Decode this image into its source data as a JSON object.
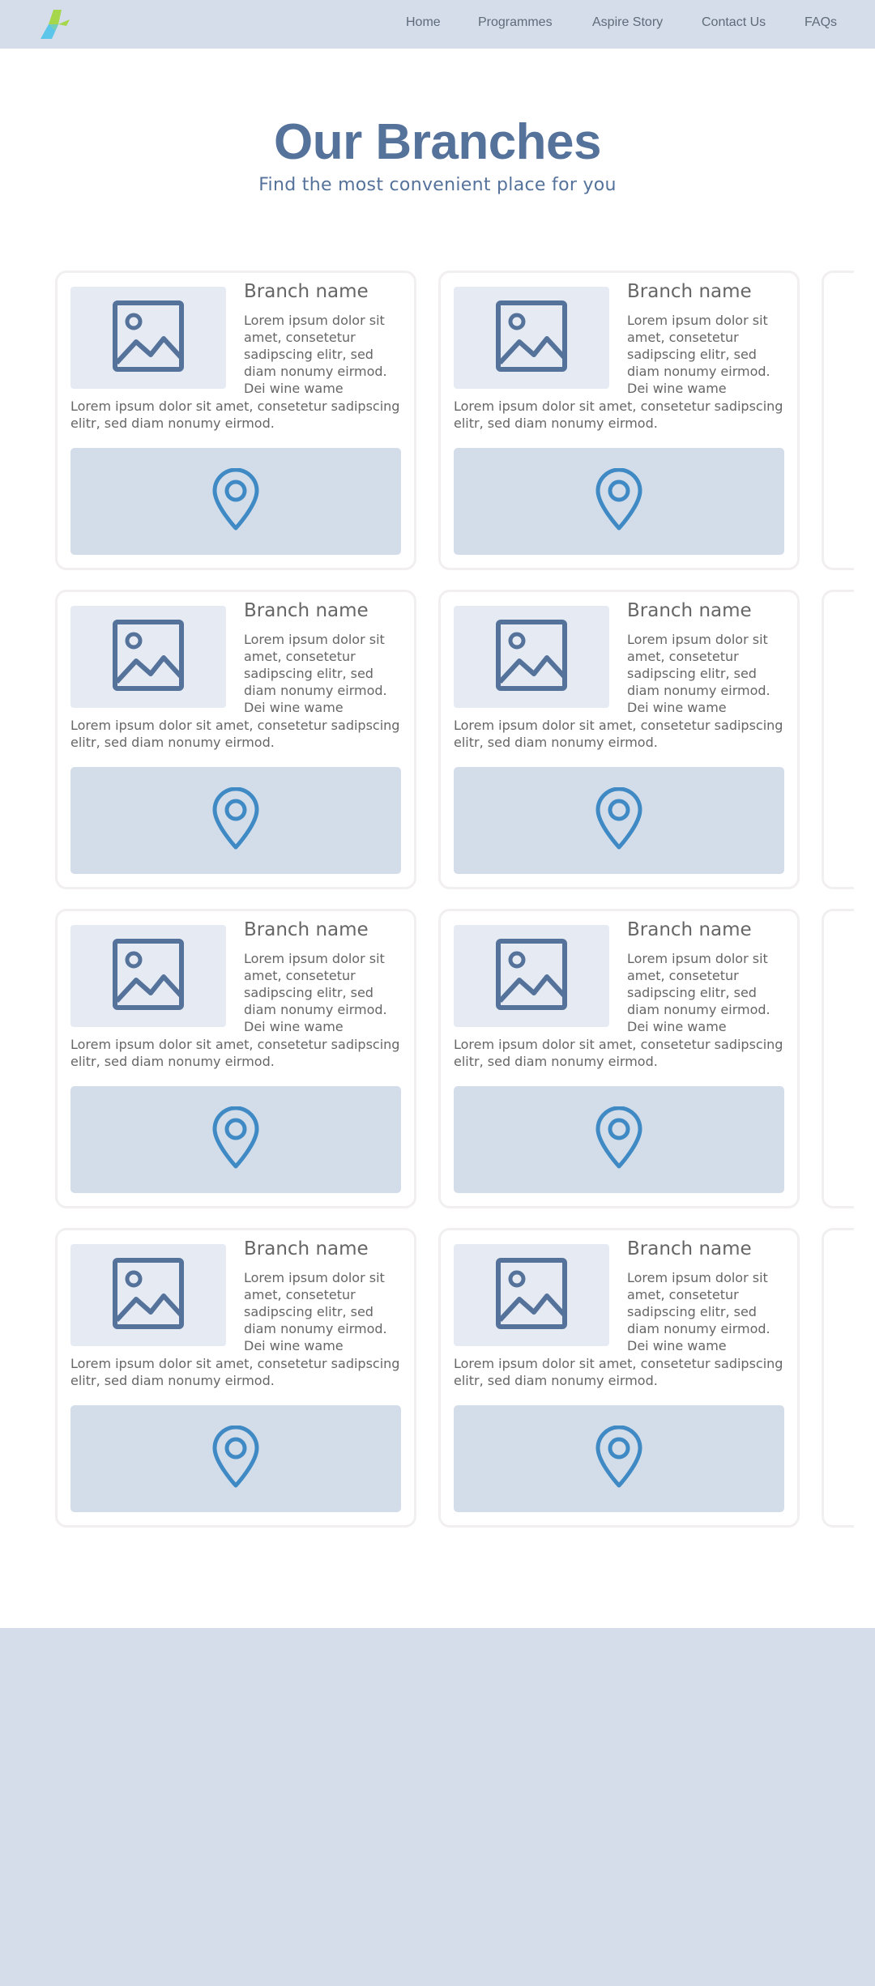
{
  "nav": {
    "items": [
      {
        "label": "Home"
      },
      {
        "label": "Programmes"
      },
      {
        "label": "Aspire Story"
      },
      {
        "label": "Contact Us"
      },
      {
        "label": "FAQs"
      }
    ]
  },
  "hero": {
    "title": "Our Branches",
    "subtitle": "Find the most convenient place for you"
  },
  "branches": [
    {
      "name": "Branch name",
      "short_desc": "Lorem ipsum dolor sit amet, consetetur sadipscing elitr, sed diam nonumy eirmod. Dei wine wame",
      "long_desc": "Lorem ipsum dolor sit amet, consetetur sadipscing elitr, sed diam nonumy eirmod."
    },
    {
      "name": "Branch name",
      "short_desc": "Lorem ipsum dolor sit amet, consetetur sadipscing elitr, sed diam nonumy eirmod. Dei wine wame",
      "long_desc": "Lorem ipsum dolor sit amet, consetetur sadipscing elitr, sed diam nonumy eirmod."
    },
    {
      "name": "Branch name",
      "short_desc": "Lorem ipsum dolor sit amet, consetetur sadipscing elitr, sed diam nonumy eirmod. Dei wine wame",
      "long_desc": "Lorem ipsum dolor sit amet, consetetur sadipscing elitr, sed diam nonumy eirmod."
    },
    {
      "name": "Branch name",
      "short_desc": "Lorem ipsum dolor sit amet, consetetur sadipscing elitr, sed diam nonumy eirmod. Dei wine wame",
      "long_desc": "Lorem ipsum dolor sit amet, consetetur sadipscing elitr, sed diam nonumy eirmod."
    },
    {
      "name": "Branch name",
      "short_desc": "Lorem ipsum dolor sit amet, consetetur sadipscing elitr, sed diam nonumy eirmod. Dei wine wame",
      "long_desc": "Lorem ipsum dolor sit amet, consetetur sadipscing elitr, sed diam nonumy eirmod."
    },
    {
      "name": "Branch name",
      "short_desc": "Lorem ipsum dolor sit amet, consetetur sadipscing elitr, sed diam nonumy eirmod. Dei wine wame",
      "long_desc": "Lorem ipsum dolor sit amet, consetetur sadipscing elitr, sed diam nonumy eirmod."
    },
    {
      "name": "Branch name",
      "short_desc": "Lorem ipsum dolor sit amet, consetetur sadipscing elitr, sed diam nonumy eirmod. Dei wine wame",
      "long_desc": "Lorem ipsum dolor sit amet, consetetur sadipscing elitr, sed diam nonumy eirmod."
    },
    {
      "name": "Branch name",
      "short_desc": "Lorem ipsum dolor sit amet, consetetur sadipscing elitr, sed diam nonumy eirmod. Dei wine wame",
      "long_desc": "Lorem ipsum dolor sit amet, consetetur sadipscing elitr, sed diam nonumy eirmod."
    }
  ],
  "icons": {
    "logo": "aspire-logo-icon",
    "image": "image-placeholder-icon",
    "map": "map-pin-icon"
  },
  "colors": {
    "nav_bg": "#d4dde9",
    "heading": "#55729b",
    "pin": "#3f8ac4",
    "image_icon": "#55729b",
    "logo_green": "#a6d64a",
    "logo_blue": "#5cc6ea"
  }
}
